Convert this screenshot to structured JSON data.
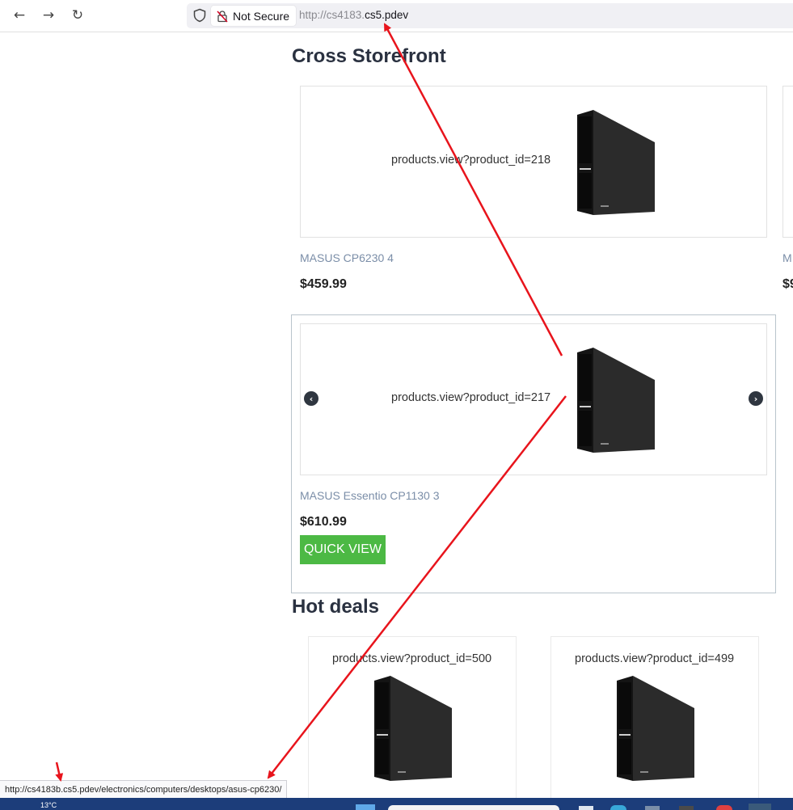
{
  "browser": {
    "security_label": "Not Secure",
    "url_prefix": "http://cs4183.",
    "url_domain": "cs5.pdev"
  },
  "storefront": {
    "title": "Cross Storefront",
    "products": [
      {
        "image_label": "products.view?product_id=218",
        "name": "MASUS CP6230 4",
        "price": "$459.99"
      },
      {
        "image_label": "products.view?product_id=217",
        "name": "MASUS Essentio CP1130 3",
        "price": "$610.99",
        "quick_view": "QUICK VIEW"
      }
    ],
    "partial_card": {
      "name_fragment": "M",
      "price_fragment": "$9"
    }
  },
  "hot_deals": {
    "title": "Hot deals",
    "products": [
      {
        "image_label": "products.view?product_id=500"
      },
      {
        "image_label": "products.view?product_id=499"
      }
    ]
  },
  "status_link": "http://cs4183b.cs5.pdev/electronics/computers/desktops/asus-cp6230/",
  "taskbar": {
    "weather": "13°C"
  },
  "annotation_color": "#e8141c"
}
